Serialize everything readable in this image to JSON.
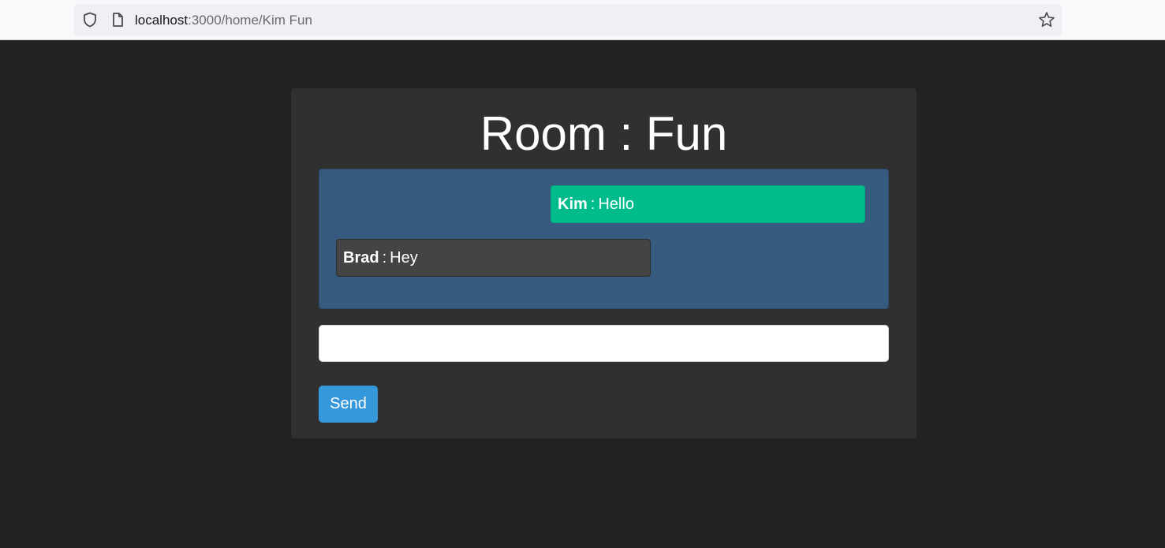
{
  "browser": {
    "url_host": "localhost",
    "url_rest": ":3000/home/Kim Fun"
  },
  "room": {
    "title": "Room : Fun"
  },
  "messages": [
    {
      "author": "Kim",
      "separator": ":",
      "text": "Hello",
      "own": true,
      "color": "#00bc8c"
    },
    {
      "author": "Brad",
      "separator": ":",
      "text": "Hey",
      "own": false,
      "color": "#444444"
    }
  ],
  "composer": {
    "value": "",
    "placeholder": "",
    "send_label": "Send",
    "send_color": "#3498db"
  },
  "colors": {
    "page_bg": "#222222",
    "card_bg": "#303030",
    "messages_bg": "#375a7f"
  }
}
